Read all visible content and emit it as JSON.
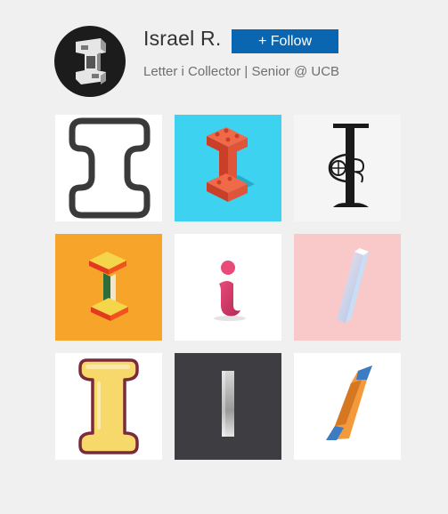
{
  "profile": {
    "name": "Israel R.",
    "bio": "Letter i Collector | Senior @ UCB",
    "avatar_icon": "block-letter-i-icon"
  },
  "follow_button": {
    "label": "+ Follow",
    "color": "#0a66b0"
  },
  "gallery": {
    "tiles": [
      {
        "icon": "outlined-capital-i-icon",
        "bg": "#ffffff"
      },
      {
        "icon": "red-brick-i-icon",
        "bg": "#3dd3f0"
      },
      {
        "icon": "ornate-decorative-i-icon",
        "bg": "#f5f5f5"
      },
      {
        "icon": "isometric-3d-i-icon",
        "bg": "#f7a52a"
      },
      {
        "icon": "pink-dot-lowercase-i-icon",
        "bg": "#ffffff"
      },
      {
        "icon": "gradient-slanted-i-icon",
        "bg": "#f9c9c9"
      },
      {
        "icon": "yellow-bubble-i-icon",
        "bg": "#ffffff"
      },
      {
        "icon": "metallic-bar-i-icon",
        "bg": "#3e3e42"
      },
      {
        "icon": "orange-blue-ribbon-i-icon",
        "bg": "#ffffff"
      }
    ]
  }
}
